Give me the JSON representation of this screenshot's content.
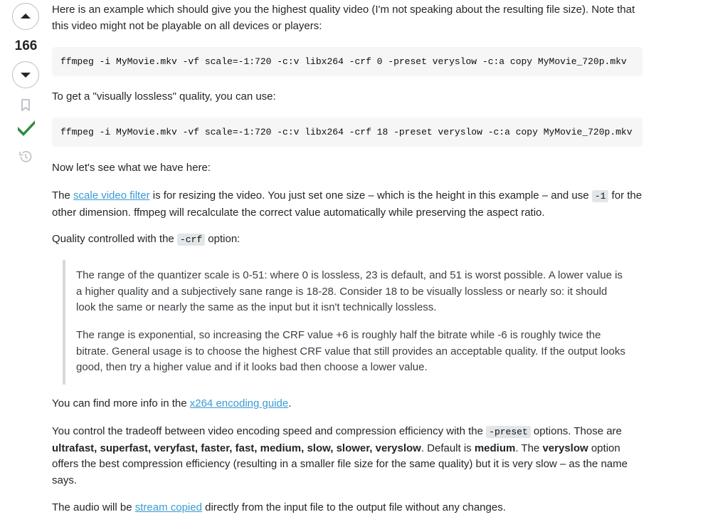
{
  "vote": {
    "count": "166"
  },
  "answer": {
    "intro": "Here is an example which should give you the highest quality video (I'm not speaking about the resulting file size). Note that this video might not be playable on all devices or players:",
    "code_lossless": "ffmpeg -i MyMovie.mkv -vf scale=-1:720 -c:v libx264 -crf 0 -preset veryslow -c:a copy MyMovie_720p.mkv",
    "visually_lossless_text": "To get a \"visually lossless\" quality, you can use:",
    "code_visually_lossless": "ffmpeg -i MyMovie.mkv -vf scale=-1:720 -c:v libx264 -crf 18 -preset veryslow -c:a copy MyMovie_720p.mkv",
    "now_text": "Now let's see what we have here:",
    "scale": {
      "prefix": "The ",
      "link": "scale video filter",
      "middle": " is for resizing the video. You just set one size – which is the height in this example – and use ",
      "code": "-1",
      "suffix": " for the other dimension. ffmpeg will recalculate the correct value automatically while preserving the aspect ratio."
    },
    "crf": {
      "prefix": "Quality controlled with the ",
      "code": "-crf",
      "suffix": " option:"
    },
    "quote": {
      "p1": "The range of the quantizer scale is 0-51: where 0 is lossless, 23 is default, and 51 is worst possible. A lower value is a higher quality and a subjectively sane range is 18-28. Consider 18 to be visually lossless or nearly so: it should look the same or nearly the same as the input but it isn't technically lossless.",
      "p2": "The range is exponential, so increasing the CRF value +6 is roughly half the bitrate while -6 is roughly twice the bitrate. General usage is to choose the highest CRF value that still provides an acceptable quality. If the output looks good, then try a higher value and if it looks bad then choose a lower value."
    },
    "guide": {
      "prefix": "You can find more info in the ",
      "link": "x264 encoding guide",
      "suffix": "."
    },
    "preset": {
      "prefix": "You control the tradeoff between video encoding speed and compression efficiency with the ",
      "code": "-preset",
      "mid1": " options. Those are ",
      "bold_list": "ultrafast, superfast, veryfast, faster, fast, medium, slow, slower, veryslow",
      "mid2": ". Default is ",
      "bold_default": "medium",
      "mid3": ". The ",
      "bold_veryslow": "veryslow",
      "suffix": " option offers the best compression efficiency (resulting in a smaller file size for the same quality) but it is very slow – as the name says."
    },
    "audio": {
      "prefix": "The audio will be ",
      "link": "stream copied",
      "suffix": " directly from the input file to the output file without any changes."
    }
  },
  "icons": {
    "upvote": "upvote-arrow-icon",
    "downvote": "downvote-arrow-icon",
    "bookmark": "bookmark-icon",
    "accepted": "accepted-checkmark-icon",
    "history": "history-icon"
  },
  "colors": {
    "accepted": "#2f8a48",
    "link": "#3a9bd4",
    "code_bg": "#f6f6f6",
    "quote_border": "#d6d9dc"
  }
}
